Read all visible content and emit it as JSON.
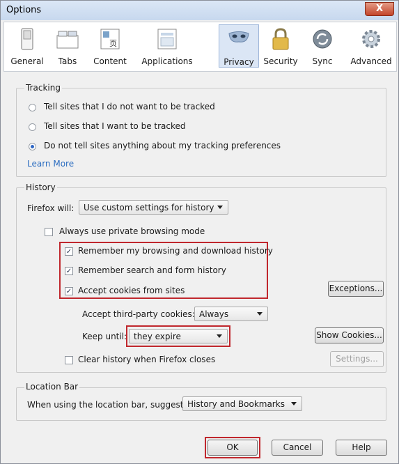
{
  "window": {
    "title": "Options",
    "close_glyph": "X"
  },
  "toolbar": {
    "tabs": [
      {
        "label": "General",
        "icon": "switch-icon"
      },
      {
        "label": "Tabs",
        "icon": "tabs-icon"
      },
      {
        "label": "Content",
        "icon": "content-icon"
      },
      {
        "label": "Applications",
        "icon": "applications-icon"
      },
      {
        "label": "Privacy",
        "icon": "mask-icon"
      },
      {
        "label": "Security",
        "icon": "padlock-icon"
      },
      {
        "label": "Sync",
        "icon": "sync-icon"
      },
      {
        "label": "Advanced",
        "icon": "gear-icon"
      }
    ],
    "selected": "Privacy"
  },
  "tracking": {
    "label": "Tracking",
    "option_do_not_track": "Tell sites that I do not want to be tracked",
    "option_track": "Tell sites that I want to be tracked",
    "option_nothing": "Do not tell sites anything about my tracking preferences",
    "selected": "option_nothing",
    "learn_more": "Learn More"
  },
  "history": {
    "label": "History",
    "firefox_will_label": "Firefox will:",
    "firefox_will_value": "Use custom settings for history",
    "private_mode": "Always use private browsing mode",
    "private_mode_checked": false,
    "remember_browsing": "Remember my browsing and download history",
    "remember_browsing_checked": true,
    "remember_search": "Remember search and form history",
    "remember_search_checked": true,
    "accept_cookies": "Accept cookies from sites",
    "accept_cookies_checked": true,
    "exceptions_button": "Exceptions...",
    "third_party_label": "Accept third-party cookies:",
    "third_party_value": "Always",
    "keep_until_label": "Keep until:",
    "keep_until_value": "they expire",
    "show_cookies_button": "Show Cookies...",
    "clear_history": "Clear history when Firefox closes",
    "clear_history_checked": false,
    "settings_button": "Settings..."
  },
  "location_bar": {
    "label": "Location Bar",
    "suggest_label": "When using the location bar, suggest:",
    "suggest_value": "History and Bookmarks"
  },
  "footer": {
    "ok": "OK",
    "cancel": "Cancel",
    "help": "Help"
  },
  "colors": {
    "highlight": "#c0272d",
    "link": "#2a6cc0",
    "selected_tab": "#dbe6f5"
  }
}
